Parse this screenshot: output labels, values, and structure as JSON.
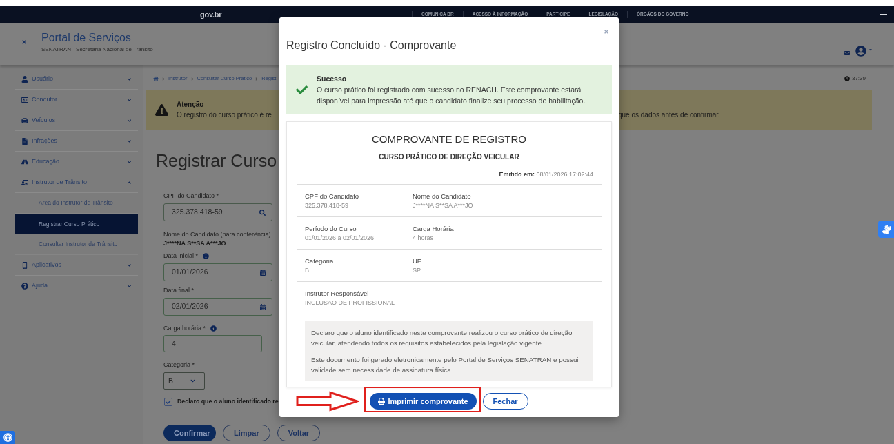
{
  "gov_bar": {
    "logo": "gov.br",
    "links": [
      "COMUNICA BR",
      "ACESSO À INFORMAÇÃO",
      "PARTICIPE",
      "LEGISLAÇÃO",
      "ÓRGÃOS DO GOVERNO"
    ]
  },
  "header": {
    "title": "Portal de Serviços",
    "subtitle": "SENATRAN - Secretaria Nacional de Trânsito"
  },
  "sidebar": {
    "items": [
      {
        "label": "Usuário",
        "expanded": false
      },
      {
        "label": "Condutor",
        "expanded": false
      },
      {
        "label": "Veículos",
        "expanded": false
      },
      {
        "label": "Infrações",
        "expanded": false
      },
      {
        "label": "Educação",
        "expanded": false
      },
      {
        "label": "Instrutor de Trânsito",
        "expanded": true,
        "children": [
          {
            "label": "Area do Instrutor de Trânsito",
            "selected": false
          },
          {
            "label": "Registrar Curso Prático",
            "selected": true
          },
          {
            "label": "Consultar Instrutor de Trânsito",
            "selected": false
          }
        ]
      },
      {
        "label": "Aplicativos",
        "expanded": false
      },
      {
        "label": "Ajuda",
        "expanded": false
      }
    ]
  },
  "breadcrumb": [
    "Instrutor",
    "Consultar Curso Prático",
    "Regist"
  ],
  "session_timer": "37:39",
  "alert": {
    "title": "Atenção",
    "text_start": "O registro do curso prático é re",
    "text_end": "que os dados antes de confirmar."
  },
  "page_title": "Registrar Curso",
  "form": {
    "fields": [
      {
        "kind": "search",
        "label": "CPF do Candidato  *",
        "value": "325.378.418-59",
        "info": false
      },
      {
        "kind": "text",
        "label": "Nome do Candidato (para conferência)",
        "value": "J****NA S**SA A***JO",
        "info": false
      },
      {
        "kind": "date",
        "label": "Data inicial  *",
        "value": "01/01/2026",
        "info": true
      },
      {
        "kind": "date",
        "label": "Data final  *",
        "value": "02/01/2026",
        "info": false
      },
      {
        "kind": "number",
        "label": "Carga horária  *",
        "value": "4",
        "info": true
      },
      {
        "kind": "select",
        "label": "Categoria  *",
        "value": "B",
        "info": false
      }
    ],
    "declaration": {
      "checked": true,
      "text": "Declaro que o aluno identificado re"
    },
    "buttons": [
      {
        "label": "Confirmar",
        "kind": "primary"
      },
      {
        "label": "Limpar",
        "kind": "outline"
      },
      {
        "label": "Voltar",
        "kind": "outline"
      }
    ]
  },
  "modal": {
    "title": "Registro Concluído - Comprovante",
    "success": {
      "title": "Sucesso",
      "text": "O curso prático foi registrado com sucesso no RENACH. Este comprovante estará disponível para impressão até que o candidato finalize seu processo de habilitação."
    },
    "receipt": {
      "title": "COMPROVANTE DE REGISTRO",
      "subtitle": "CURSO PRÁTICO DE DIREÇÃO VEICULAR",
      "issued": "**Emitido em:** 08/01/2026 17:02:44",
      "rows": [
        [
          {
            "label": "CPF do Candidato",
            "value": "325.378.418-59"
          },
          {
            "label": "Nome do Candidato",
            "value": "J****NA S**SA A***JO"
          }
        ],
        [
          {
            "label": "Período do Curso",
            "value": "01/01/2026 a 02/01/2026"
          },
          {
            "label": "Carga Horária",
            "value": "4 horas"
          }
        ],
        [
          {
            "label": "Categoria",
            "value": "B"
          },
          {
            "label": "UF",
            "value": "SP"
          }
        ],
        [
          {
            "label": "Instrutor Responsável",
            "value": "INCLUSAO DE PROFISSIONAL"
          }
        ]
      ],
      "notes": [
        "Declaro que o aluno identificado neste comprovante realizou o curso prático de direção veicular, atendendo todos os requisitos estabelecidos pela legislação vigente.",
        "Este documento foi gerado eletronicamente pelo Portal de Serviços SENATRAN e possui validade sem necessidade de assinatura física."
      ]
    },
    "buttons": [
      {
        "label": "Imprimir comprovante",
        "kind": "primary",
        "highlighted": true
      },
      {
        "label": "Fechar",
        "kind": "outline",
        "highlighted": false
      }
    ]
  }
}
